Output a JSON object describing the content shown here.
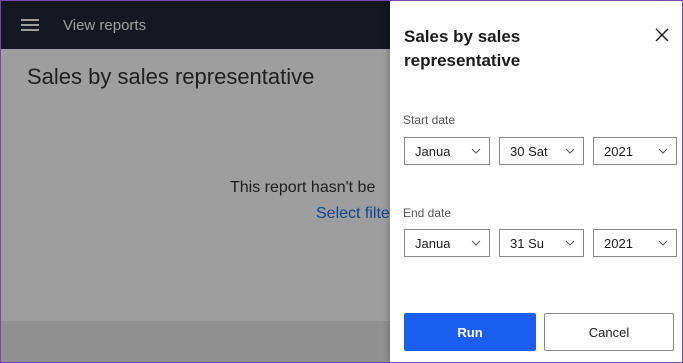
{
  "app": {
    "title": "View reports",
    "page_title": "Sales by sales representative",
    "empty_message": "This report hasn't be",
    "select_filters": "Select filte"
  },
  "panel": {
    "title": "Sales by sales representative",
    "start_label": "Start date",
    "end_label": "End date",
    "start": {
      "month": "Janua",
      "day": "30 Sat",
      "year": "2021"
    },
    "end": {
      "month": "Janua",
      "day": "31 Su",
      "year": "2021"
    },
    "run_label": "Run",
    "cancel_label": "Cancel"
  },
  "icons": {
    "menu": "hamburger-icon",
    "close": "close-icon",
    "dropdown": "chevron-down-icon"
  },
  "colors": {
    "accent": "#1a5ff0",
    "appbar": "#202736",
    "window_border": "#7a43b6"
  }
}
